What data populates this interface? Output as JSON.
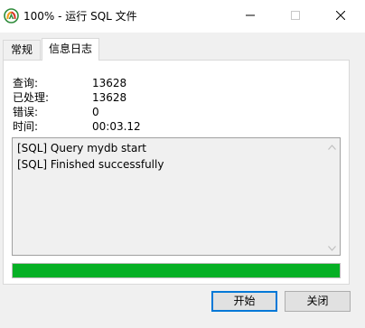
{
  "window": {
    "title": "100% - 运行 SQL 文件"
  },
  "tabs": [
    {
      "label": "常规"
    },
    {
      "label": "信息日志"
    }
  ],
  "info": {
    "query_label": "查询:",
    "query_value": "13628",
    "processed_label": "已处理:",
    "processed_value": "13628",
    "errors_label": "错误:",
    "errors_value": "0",
    "time_label": "时间:",
    "time_value": "00:03.12"
  },
  "log": {
    "lines": [
      "[SQL] Query mydb start",
      "[SQL] Finished successfully"
    ]
  },
  "progress": {
    "fraction": 1.0,
    "color": "#06b025"
  },
  "buttons": {
    "start_label": "开始",
    "close_label": "关闭"
  },
  "icons": {
    "app": "navicat-logo-icon",
    "minimize": "minimize-icon",
    "maximize": "maximize-icon",
    "close": "close-icon",
    "scroll_up": "chevron-up-icon",
    "scroll_down": "chevron-down-icon"
  }
}
